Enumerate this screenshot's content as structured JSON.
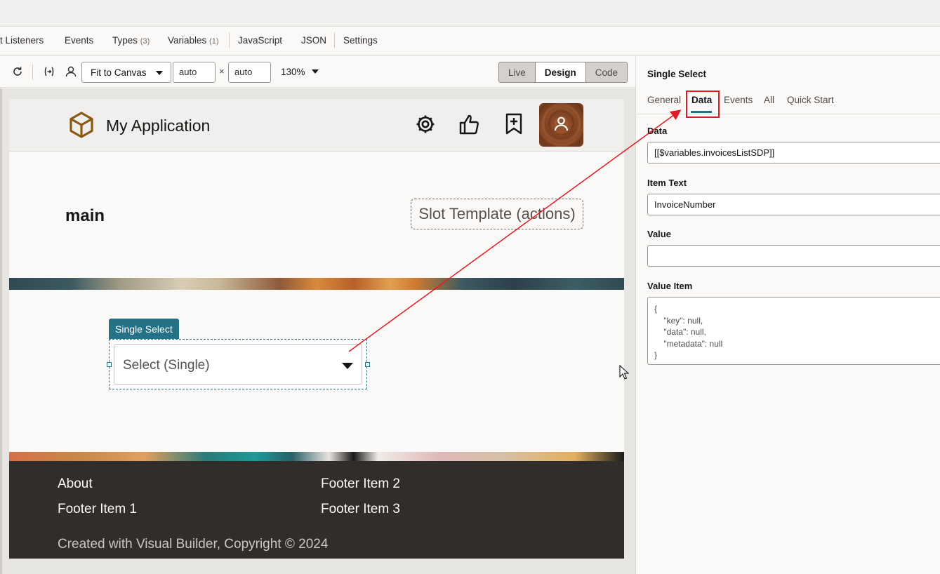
{
  "tabs": [
    {
      "label": "t Listeners",
      "count": ""
    },
    {
      "label": "Events",
      "count": ""
    },
    {
      "label": "Types",
      "count": "(3)"
    },
    {
      "label": "Variables",
      "count": "(1)"
    },
    {
      "label": "JavaScript",
      "count": ""
    },
    {
      "label": "JSON",
      "count": ""
    },
    {
      "label": "Settings",
      "count": ""
    }
  ],
  "toolbar": {
    "fit_label": "Fit to Canvas",
    "width_value": "auto",
    "height_value": "auto",
    "times": "×",
    "zoom": "130%",
    "modes": [
      "Live",
      "Design",
      "Code"
    ]
  },
  "app": {
    "title": "My Application",
    "main_heading": "main",
    "slot_label": "Slot Template (actions)",
    "component_badge": "Single Select",
    "select_placeholder": "Select (Single)"
  },
  "footer": {
    "links": [
      "About",
      "Footer Item 1",
      "Footer Item 2",
      "Footer Item 3"
    ],
    "copyright": "Created with Visual Builder, Copyright © 2024"
  },
  "panel": {
    "title": "Single Select",
    "tabs": [
      "General",
      "Data",
      "Events",
      "All",
      "Quick Start"
    ],
    "active_tab": "Data",
    "fields": {
      "data_label": "Data",
      "data_value": "[[$variables.invoicesListSDP]]",
      "item_text_label": "Item Text",
      "item_text_value": "InvoiceNumber",
      "value_label": "Value",
      "value_value": "",
      "value_item_label": "Value Item",
      "value_item_value": "{\n    \"key\": null,\n    \"data\": null,\n    \"metadata\": null\n}"
    }
  },
  "colors": {
    "accent": "#257185",
    "annotation": "#e11b22",
    "footer_bg": "#312d2a",
    "app_icon": "#8a5a12"
  }
}
